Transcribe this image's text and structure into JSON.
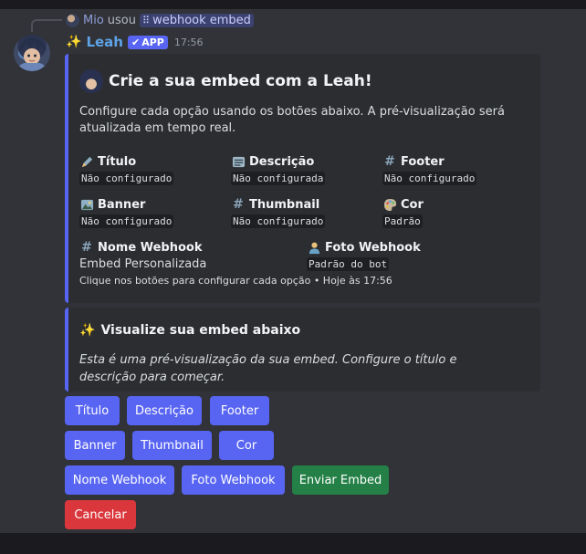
{
  "reply": {
    "user": "Mio",
    "verb": "usou",
    "command": "webhook embed"
  },
  "message": {
    "author": "Leah",
    "badge": "APP",
    "time": "17:56"
  },
  "embed_main": {
    "title": "Crie a sua embed com a Leah!",
    "description": "Configure cada opção usando os botões abaixo. A pré-visualização será atualizada em tempo real.",
    "fields": [
      {
        "name": "Título",
        "value": "Não configurado",
        "icon": "pencil-icon"
      },
      {
        "name": "Descrição",
        "value": "Não configurada",
        "icon": "notepad-icon"
      },
      {
        "name": "Footer",
        "value": "Não configurado",
        "icon": "hash-icon"
      },
      {
        "name": "Banner",
        "value": "Não configurado",
        "icon": "image-icon"
      },
      {
        "name": "Thumbnail",
        "value": "Não configurado",
        "icon": "hash-icon"
      },
      {
        "name": "Cor",
        "value": "Padrão",
        "icon": "palette-icon"
      },
      {
        "name": "Nome Webhook",
        "value": "Embed Personalizada",
        "icon": "hash-icon"
      },
      {
        "name": "Foto Webhook",
        "value": "Padrão do bot",
        "icon": "person-icon"
      }
    ],
    "footer": "Clique nos botões para configurar cada opção • Hoje às 17:56"
  },
  "embed_preview": {
    "title": "Visualize sua embed abaixo",
    "description": "Esta é uma pré-visualização da sua embed. Configure o título e descrição para começar."
  },
  "buttons": {
    "titulo": "Título",
    "descricao": "Descrição",
    "footer": "Footer",
    "banner": "Banner",
    "thumbnail": "Thumbnail",
    "cor": "Cor",
    "nome_webhook": "Nome Webhook",
    "foto_webhook": "Foto Webhook",
    "enviar": "Enviar Embed",
    "cancelar": "Cancelar"
  },
  "colors": {
    "background": "#313338",
    "embed_bg": "#2b2d31",
    "accent": "#5865f2",
    "success": "#248046",
    "danger": "#da373c"
  }
}
